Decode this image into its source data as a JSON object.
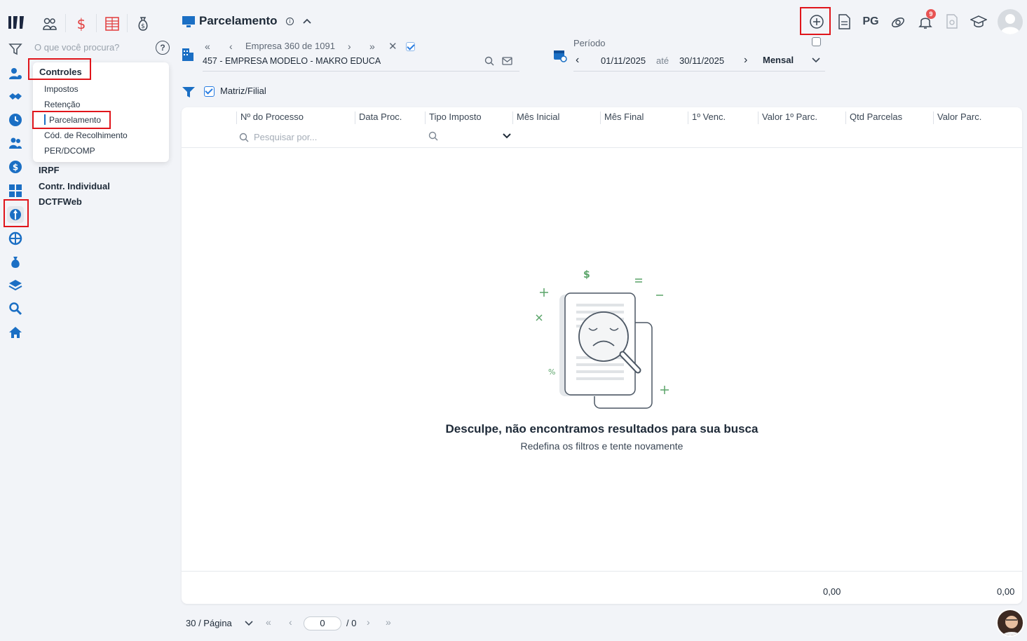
{
  "app": {
    "page_title": "Parcelamento"
  },
  "search": {
    "placeholder": "O que você procura?"
  },
  "menu": {
    "group_label": "Controles",
    "subitems": [
      "Impostos",
      "Retenção",
      "Parcelamento",
      "Cód. de Recolhimento",
      "PER/DCOMP"
    ],
    "top_items": [
      "IRPF",
      "Contr. Individual",
      "DCTFWeb"
    ]
  },
  "company_nav": {
    "label": "Empresa 360 de 1091",
    "company": "457 - EMPRESA MODELO - MAKRO EDUCA"
  },
  "period": {
    "label": "Período",
    "start": "01/11/2025",
    "separator": "até",
    "end": "30/11/2025",
    "frequency": "Mensal"
  },
  "header": {
    "pg_label": "PG",
    "notification_count": "9"
  },
  "filter": {
    "matriz_filial_label": "Matriz/Filial"
  },
  "table": {
    "columns": [
      "Nº do Processo",
      "Data Proc.",
      "Tipo Imposto",
      "Mês Inicial",
      "Mês Final",
      "1º Venc.",
      "Valor 1º Parc.",
      "Qtd Parcelas",
      "Valor Parc."
    ],
    "search_placeholder": "Pesquisar por...",
    "empty_title": "Desculpe, não encontramos resultados para sua busca",
    "empty_subtitle": "Redefina os filtros e tente novamente",
    "totals": [
      "0,00",
      "0,00"
    ]
  },
  "pagination": {
    "per_page": "30 / Página",
    "current_page": "0",
    "total_pages": "/ 0"
  },
  "colors": {
    "accent": "#1b6fc4",
    "highlight": "#e0151b",
    "icon_red": "#e23b3b",
    "green": "#5aa469"
  }
}
